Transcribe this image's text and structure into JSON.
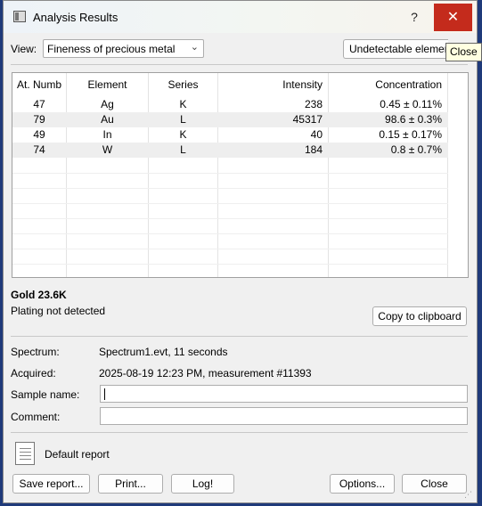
{
  "window": {
    "title": "Analysis Results",
    "help_label": "?",
    "close_glyph": "✕",
    "tooltip": "Close"
  },
  "view": {
    "label": "View:",
    "selected": "Fineness of precious metal",
    "undetectable_button": "Undetectable elements"
  },
  "table": {
    "headers": [
      "At. Numb",
      "Element",
      "Series",
      "Intensity",
      "Concentration"
    ],
    "rows": [
      {
        "num": "47",
        "element": "Ag",
        "series": "K",
        "intensity": "238",
        "concentration": "0.45 ± 0.11%"
      },
      {
        "num": "79",
        "element": "Au",
        "series": "L",
        "intensity": "45317",
        "concentration": "98.6 ± 0.3%"
      },
      {
        "num": "49",
        "element": "In",
        "series": "K",
        "intensity": "40",
        "concentration": "0.15 ± 0.17%"
      },
      {
        "num": "74",
        "element": "W",
        "series": "L",
        "intensity": "184",
        "concentration": "0.8 ± 0.7%"
      }
    ]
  },
  "result": {
    "headline": "Gold 23.6K",
    "plating": "Plating not detected",
    "copy_button": "Copy to clipboard"
  },
  "info": {
    "spectrum_label": "Spectrum:",
    "spectrum_value": "Spectrum1.evt,  11 seconds",
    "acquired_label": "Acquired:",
    "acquired_value": "2025-08-19  12:23 PM,  measurement #11393",
    "sample_label": "Sample name:",
    "sample_value": "",
    "comment_label": "Comment:",
    "comment_value": ""
  },
  "report": {
    "name": "Default report"
  },
  "buttons": {
    "save": "Save report...",
    "print": "Print...",
    "log": "Log!",
    "options": "Options...",
    "close": "Close"
  },
  "icons": {
    "app": "app-window-icon",
    "document": "document-icon",
    "dropdown": "chevron-down-icon",
    "resize": "resize-grip-icon"
  },
  "colors": {
    "close_button": "#c42b1c",
    "tooltip_bg": "#ffffe1",
    "alt_row": "#eeeeee"
  }
}
